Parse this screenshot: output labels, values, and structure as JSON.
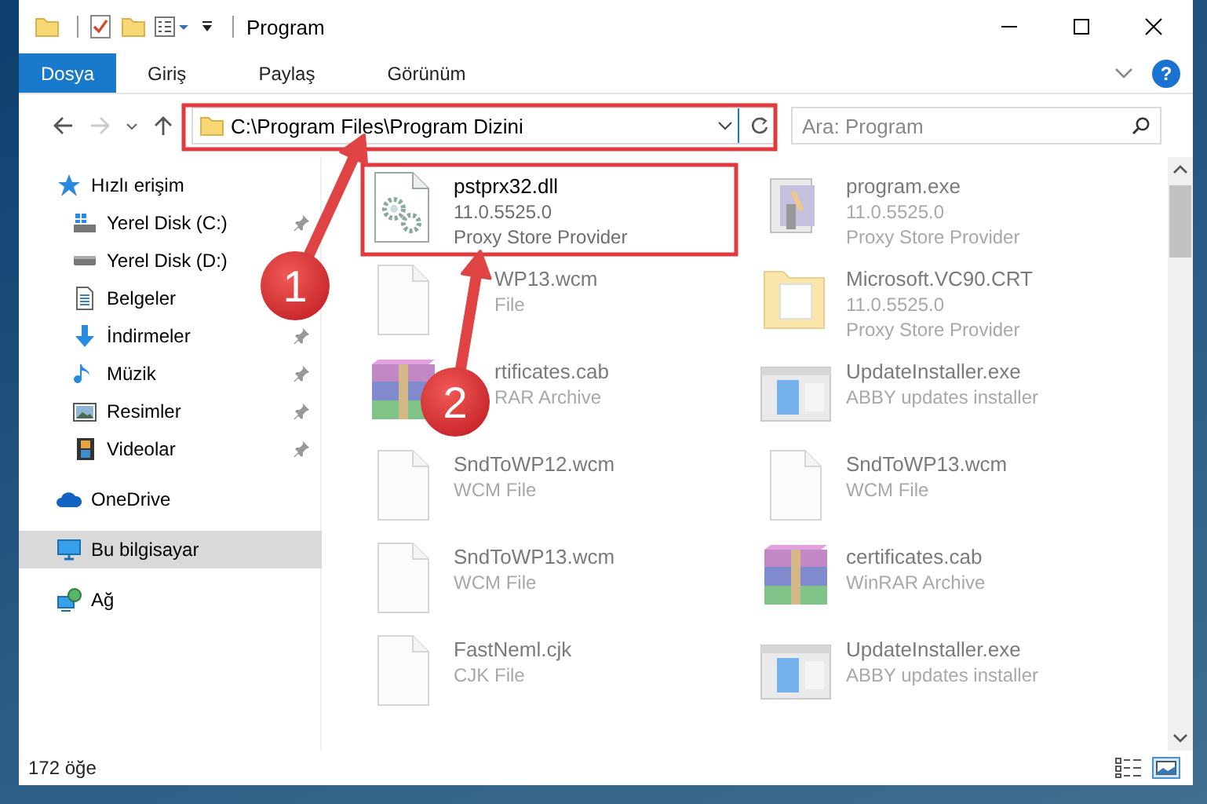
{
  "window": {
    "title": "Program"
  },
  "ribbon": {
    "tabs": [
      {
        "label": "Dosya",
        "selected": true
      },
      {
        "label": "Giriş",
        "selected": false
      },
      {
        "label": "Paylaş",
        "selected": false
      },
      {
        "label": "Görünüm",
        "selected": false
      }
    ],
    "help_label": "?"
  },
  "address_bar": {
    "path": "C:\\Program Files\\Program Dizini"
  },
  "search": {
    "placeholder": "Ara: Program"
  },
  "sidebar": {
    "items": [
      {
        "label": "Hızlı erişim",
        "kind": "star",
        "selected": false,
        "children": [
          {
            "label": "Yerel Disk (C:)",
            "kind": "drive-win",
            "pinned": true,
            "selected": false
          },
          {
            "label": "Yerel Disk (D:)",
            "kind": "drive",
            "selected": false
          },
          {
            "label": "Belgeler",
            "kind": "document",
            "selected": false
          },
          {
            "label": "İndirmeler",
            "kind": "download",
            "pinned": true,
            "selected": false
          },
          {
            "label": "Müzik",
            "kind": "music",
            "pinned": true,
            "selected": false
          },
          {
            "label": "Resimler",
            "kind": "pictures",
            "pinned": true,
            "selected": false
          },
          {
            "label": "Videolar",
            "kind": "video",
            "pinned": true,
            "selected": false
          }
        ]
      },
      {
        "label": "OneDrive",
        "kind": "cloud",
        "selected": false
      },
      {
        "label": "Bu bilgisayar",
        "kind": "monitor",
        "selected": true
      },
      {
        "label": "Ağ",
        "kind": "network",
        "selected": false
      }
    ]
  },
  "files": [
    {
      "name": "pstprx32.dll",
      "lines": [
        "11.0.5525.0",
        "Proxy Store Provider"
      ],
      "kind": "dll",
      "blurred": false
    },
    {
      "name": "program.exe",
      "lines": [
        "11.0.5525.0",
        "Proxy Store Provider"
      ],
      "kind": "exe",
      "blurred": true
    },
    {
      "name": "WP13.wcm",
      "lines": [
        "File"
      ],
      "kind": "blank",
      "blurred": true,
      "partly_covered": true
    },
    {
      "name": "Microsoft.VC90.CRT",
      "lines": [
        "11.0.5525.0",
        "Proxy Store Provider"
      ],
      "kind": "folder",
      "blurred": true
    },
    {
      "name": "rtificates.cab",
      "lines": [
        "RAR Archive"
      ],
      "kind": "archive",
      "blurred": true,
      "partly_covered": true
    },
    {
      "name": "UpdateInstaller.exe",
      "lines": [
        "ABBY updates installer"
      ],
      "kind": "installer",
      "blurred": true
    },
    {
      "name": "SndToWP12.wcm",
      "lines": [
        "WCM File"
      ],
      "kind": "blank",
      "blurred": true
    },
    {
      "name": "SndToWP13.wcm",
      "lines": [
        "WCM File"
      ],
      "kind": "blank",
      "blurred": true
    },
    {
      "name": "SndToWP13.wcm",
      "lines": [
        "WCM File"
      ],
      "kind": "blank",
      "blurred": true
    },
    {
      "name": "certificates.cab",
      "lines": [
        "WinRAR Archive"
      ],
      "kind": "archive",
      "blurred": true
    },
    {
      "name": "FastNeml.cjk",
      "lines": [
        "CJK File"
      ],
      "kind": "blank",
      "blurred": true
    },
    {
      "name": "UpdateInstaller.exe",
      "lines": [
        "ABBY updates installer"
      ],
      "kind": "installer",
      "blurred": true
    }
  ],
  "status_bar": {
    "count": "172 öğe"
  },
  "annotations": [
    {
      "label": "1"
    },
    {
      "label": "2"
    }
  ]
}
